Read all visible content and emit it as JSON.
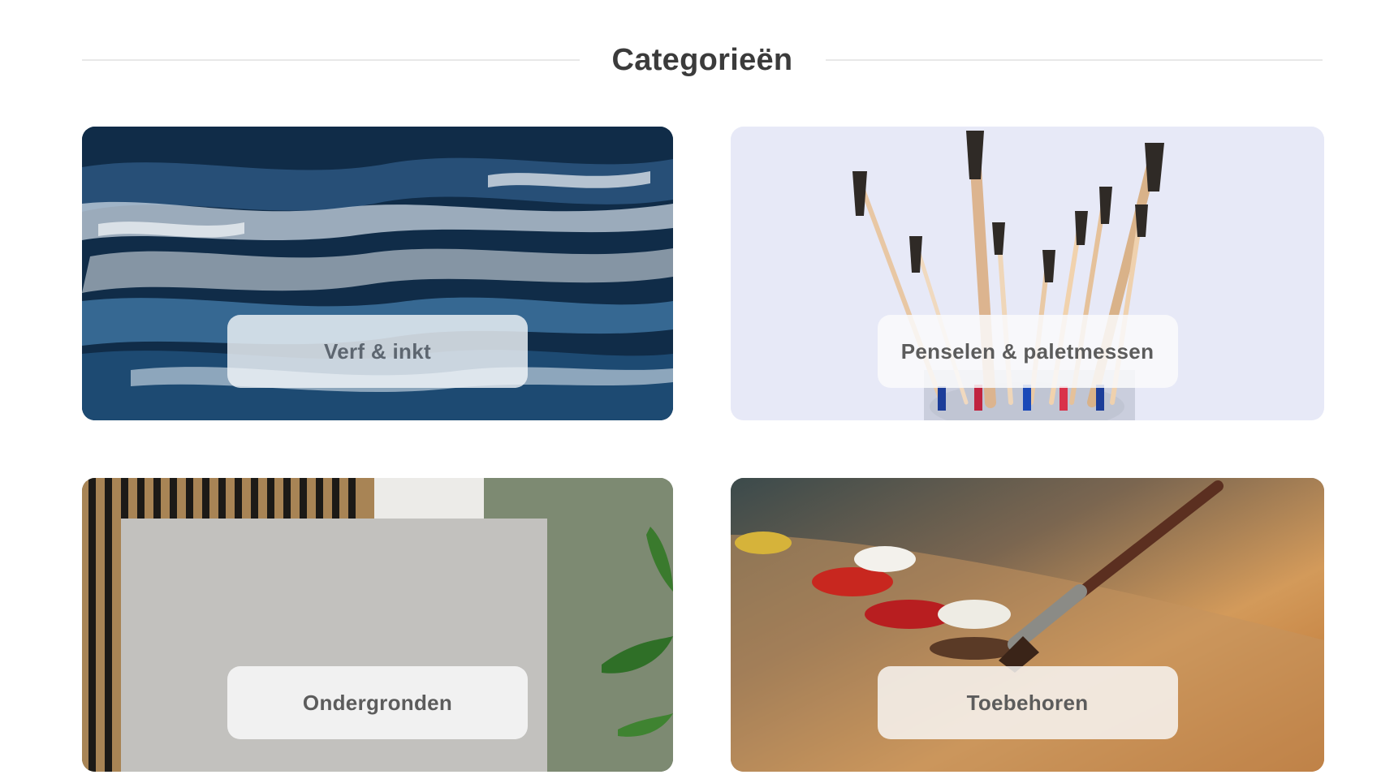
{
  "section": {
    "title": "Categorieën"
  },
  "categories": [
    {
      "label": "Verf & inkt",
      "image": "abstract-blue-paint-image"
    },
    {
      "label": "Penselen & paletmessen",
      "image": "brushes-in-jar-image"
    },
    {
      "label": "Ondergronden",
      "image": "canvas-board-image"
    },
    {
      "label": "Toebehoren",
      "image": "palette-with-brush-image"
    }
  ]
}
